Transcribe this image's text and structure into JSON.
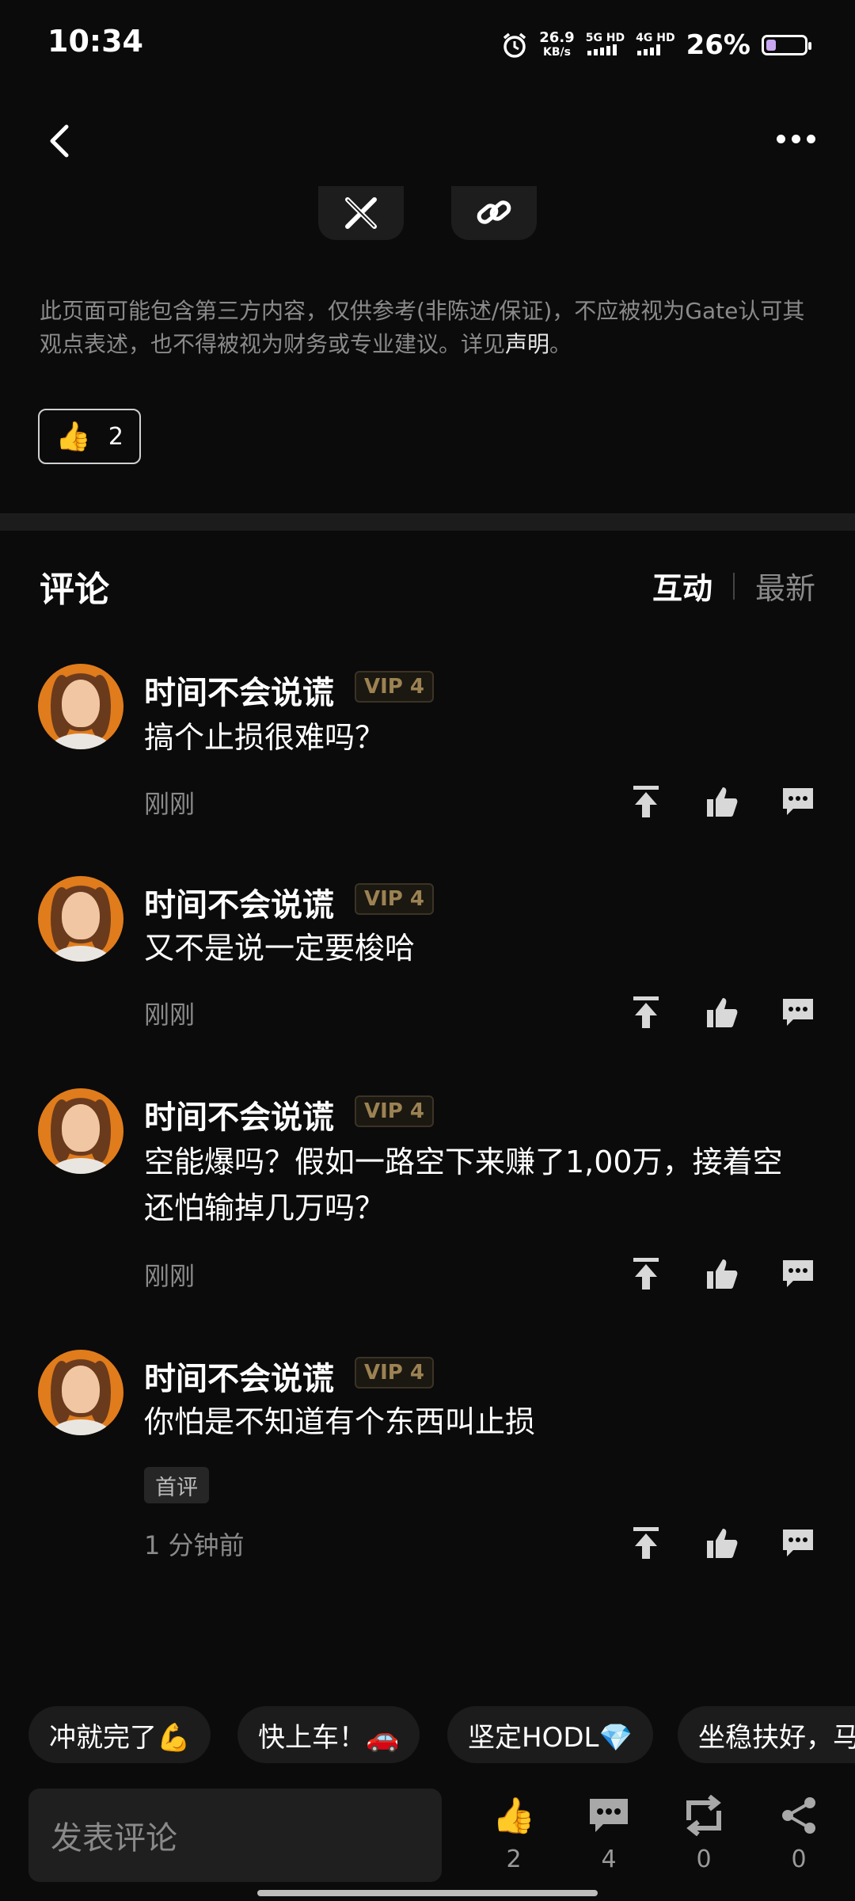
{
  "status_bar": {
    "time": "10:34",
    "speed_value": "26.9",
    "speed_unit": "KB/s",
    "net1": "5G HD",
    "net2": "4G HD",
    "battery_pct": "26%",
    "battery_level": 0.26
  },
  "disclaimer": {
    "text": "此页面可能包含第三方内容，仅供参考(非陈述/保证)，不应被视为Gate认可其观点表述，也不得被视为财务或专业建议。详见",
    "link": "声明",
    "end": "。"
  },
  "post_like": {
    "emoji": "👍",
    "count": "2"
  },
  "comments_section": {
    "title": "评论",
    "sort_active": "互动",
    "sort_inactive": "最新"
  },
  "comments": [
    {
      "user": "时间不会说谎",
      "vip": "VIP 4",
      "text": "搞个止损很难吗？",
      "time": "刚刚"
    },
    {
      "user": "时间不会说谎",
      "vip": "VIP 4",
      "text": "又不是说一定要梭哈",
      "time": "刚刚"
    },
    {
      "user": "时间不会说谎",
      "vip": "VIP 4",
      "text": "空能爆吗？假如一路空下来赚了1,00万，接着空还怕输掉几万吗？",
      "time": "刚刚"
    },
    {
      "user": "时间不会说谎",
      "vip": "VIP 4",
      "text": "你怕是不知道有个东西叫止损",
      "tag": "首评",
      "time": "1 分钟前"
    }
  ],
  "quick_replies": [
    "冲就完了💪",
    "快上车！🚗",
    "坚定HODL💎",
    "坐稳扶好，马"
  ],
  "bottom_bar": {
    "input_placeholder": "发表评论",
    "like_count": "2",
    "comment_count": "4",
    "repost_count": "0",
    "share_count": "0"
  },
  "colors": {
    "background": "#0b0b0b",
    "vip_gold": "#9c8253",
    "muted": "#8a8a8a"
  },
  "icons": [
    "back-icon",
    "more-icon",
    "x-logo-icon",
    "link-icon",
    "pin-icon",
    "thumb-up-icon",
    "reply-icon",
    "repost-icon",
    "share-icon",
    "alarm-icon"
  ]
}
